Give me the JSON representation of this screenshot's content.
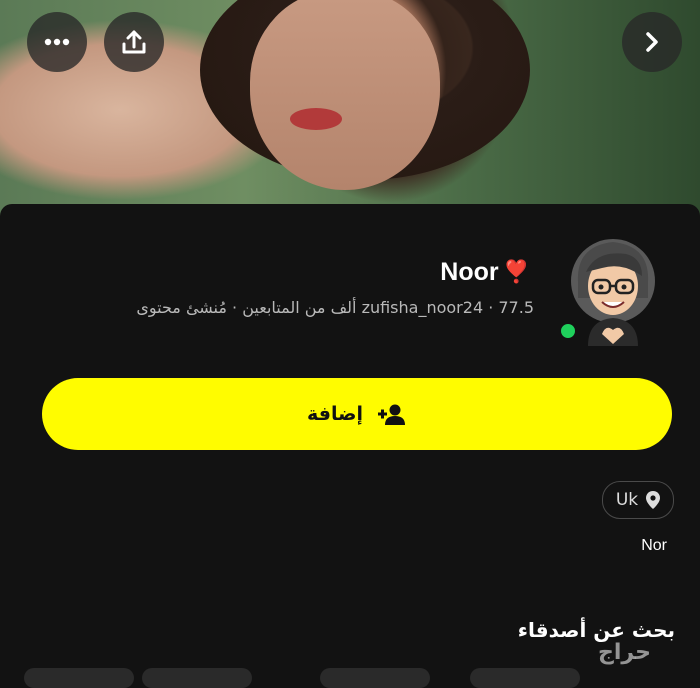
{
  "hero": {
    "more_icon": "more-horizontal-icon",
    "share_icon": "share-upload-icon",
    "next_icon": "chevron-right-icon"
  },
  "profile": {
    "display_name": "Noor",
    "name_emoji": "❣️",
    "meta_line": "zufisha_noor24 · 77.5 ألف من المتابعين · مُنشئ محتوى",
    "online": true,
    "avatar_icon": "bitmoji-avatar"
  },
  "actions": {
    "add_label": "إضافة",
    "add_icon": "add-friend-icon"
  },
  "location": {
    "label": "Uk",
    "icon": "location-pin-icon"
  },
  "bio": "Nor",
  "sections": {
    "find_friends_title": "بحث عن أصدقاء"
  },
  "watermark": "حراج",
  "colors": {
    "accent": "#fffc00",
    "background": "#121212",
    "online": "#1fd05c"
  }
}
